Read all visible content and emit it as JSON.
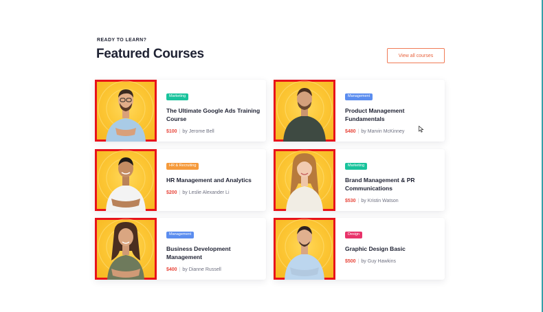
{
  "section": {
    "eyebrow": "READY TO LEARN?",
    "title": "Featured Courses",
    "view_all_label": "View all courses"
  },
  "colors": {
    "accent": "#e8603a",
    "price": "#e8453a",
    "thumb_bg": "#fcc634",
    "highlight_border": "#e8131a"
  },
  "courses": [
    {
      "badge": "Marketing",
      "badge_color": "#19c39c",
      "title": "The Ultimate Google Ads Training Course",
      "price": "$100",
      "author_label": "by Jerome Bell"
    },
    {
      "badge": "Management",
      "badge_color": "#5b8def",
      "title": "Product Management Fundamentals",
      "price": "$480",
      "author_label": "by Marvin McKinney"
    },
    {
      "badge": "HR & Recruiting",
      "badge_color": "#f59a3b",
      "title": "HR  Management and Analytics",
      "price": "$200",
      "author_label": "by Leslie Alexander Li"
    },
    {
      "badge": "Marketing",
      "badge_color": "#19c39c",
      "title": "Brand Management & PR Communications",
      "price": "$530",
      "author_label": "by Kristin Watson"
    },
    {
      "badge": "Management",
      "badge_color": "#5b8def",
      "title": "Business Development Management",
      "price": "$400",
      "author_label": "by Dianne Russell"
    },
    {
      "badge": "Design",
      "badge_color": "#e8336a",
      "title": "Graphic Design Basic",
      "price": "$500",
      "author_label": "by Guy Hawkins"
    }
  ]
}
